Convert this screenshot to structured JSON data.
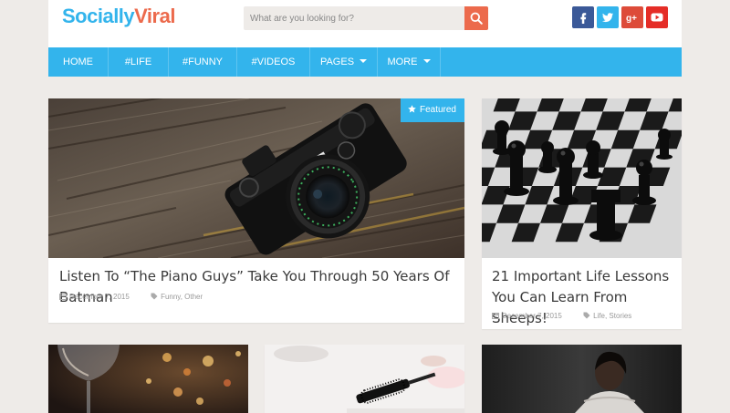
{
  "brand": {
    "part1": "Socially",
    "part2": "Viral"
  },
  "search": {
    "placeholder": "What are you looking for?"
  },
  "social": [
    "facebook-icon",
    "twitter-icon",
    "google-plus-icon",
    "youtube-icon"
  ],
  "nav": {
    "items": [
      {
        "label": "HOME"
      },
      {
        "label": "#LIFE"
      },
      {
        "label": "#FUNNY"
      },
      {
        "label": "#VIDEOS"
      },
      {
        "label": "PAGES"
      },
      {
        "label": "MORE"
      }
    ]
  },
  "posts": [
    {
      "title": "Listen To “The Piano Guys” Take You Through 50 Years Of Batman",
      "date": "December 7, 2015",
      "tags": "Funny, Other",
      "badge": "Featured",
      "image": "camera-on-wood"
    },
    {
      "title": "21 Important Life Lessons You Can Learn From Sheeps!",
      "date": "December 7, 2015",
      "tags": "Life, Stories",
      "image": "chess-board"
    },
    {
      "image": "wine-glass-bokeh"
    },
    {
      "image": "mascara-makeup"
    },
    {
      "image": "woman-portrait"
    }
  ],
  "colors": {
    "accent": "#33b4ec",
    "logo_second": "#ec6a4c",
    "search_button": "#ec6a4c",
    "background": "#eeebe8"
  }
}
